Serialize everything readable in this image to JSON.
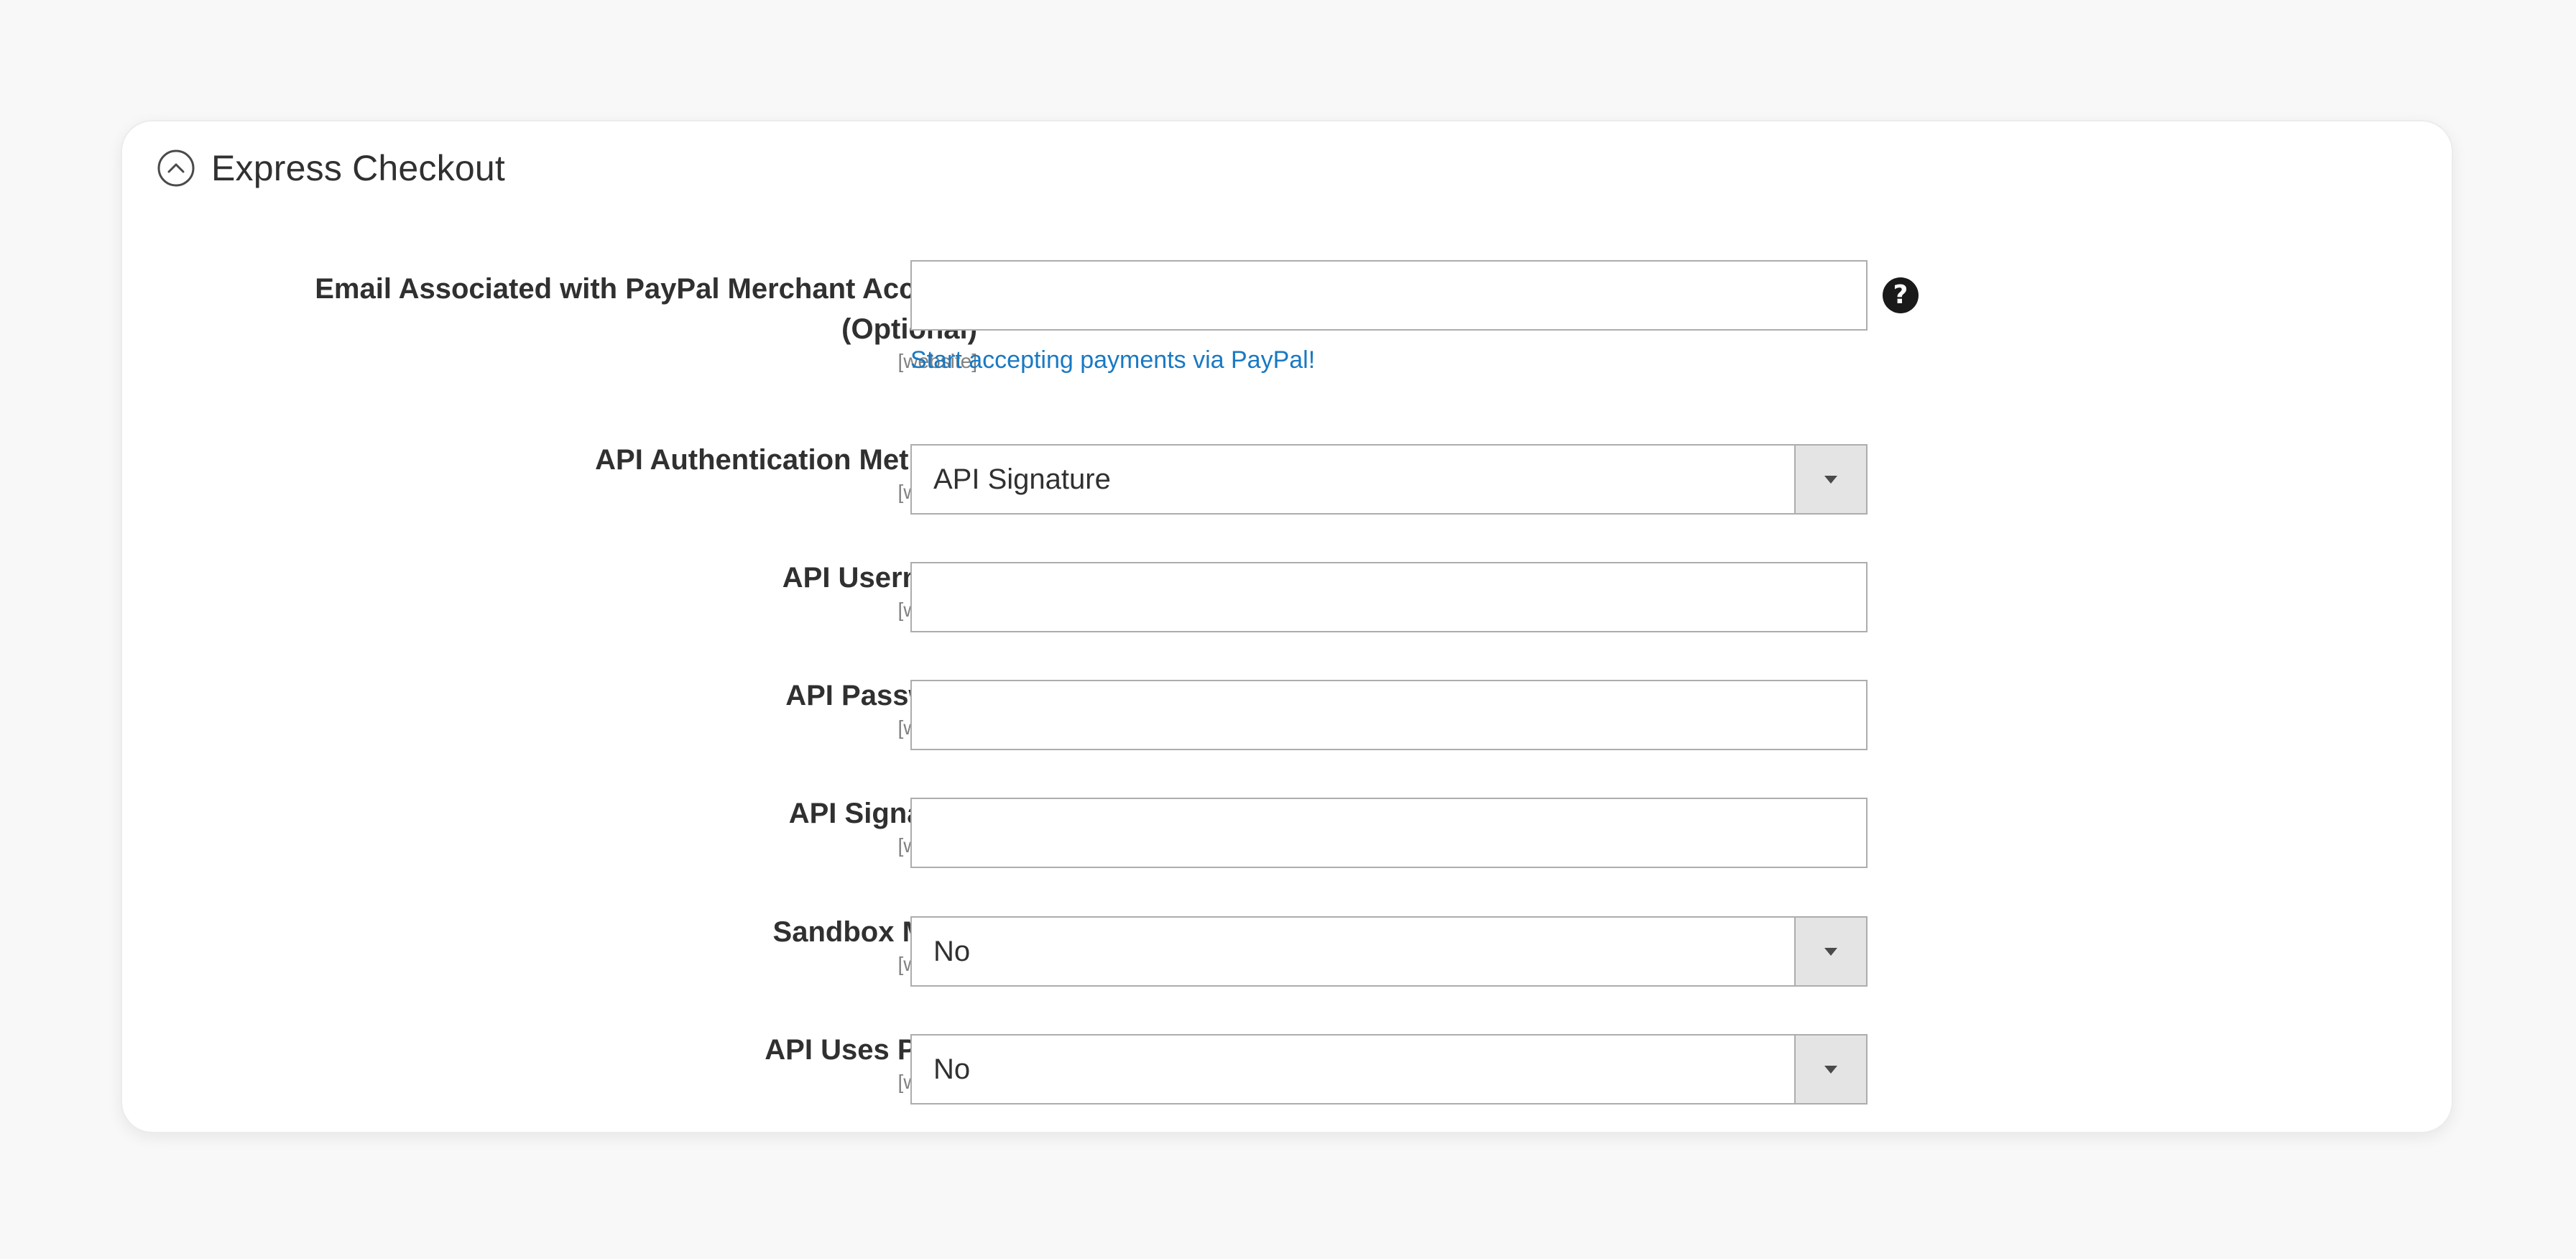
{
  "section": {
    "title": "Express Checkout"
  },
  "fields": {
    "email": {
      "label": "Email Associated with PayPal Merchant Account",
      "label2": "(Optional)",
      "scope": "[website]",
      "value": "",
      "note": "Start accepting payments via PayPal!"
    },
    "auth_method": {
      "label": "API Authentication Methods",
      "scope": "[website]",
      "value": "API Signature"
    },
    "username": {
      "label": "API Username",
      "scope": "[website]",
      "value": ""
    },
    "password": {
      "label": "API Password",
      "scope": "[website]",
      "value": ""
    },
    "signature": {
      "label": "API Signature",
      "scope": "[website]",
      "value": ""
    },
    "sandbox": {
      "label": "Sandbox Mode",
      "scope": "[website]",
      "value": "No"
    },
    "proxy": {
      "label": "API Uses Proxy",
      "scope": "[website]",
      "value": "No"
    }
  },
  "icons": {
    "collapse": "chevron-up-circle-icon",
    "help": "question-circle-icon",
    "help_glyph": "?"
  },
  "colors": {
    "link": "#1979c3",
    "page_bg": "#f8f8f8",
    "card_bg": "#ffffff"
  }
}
